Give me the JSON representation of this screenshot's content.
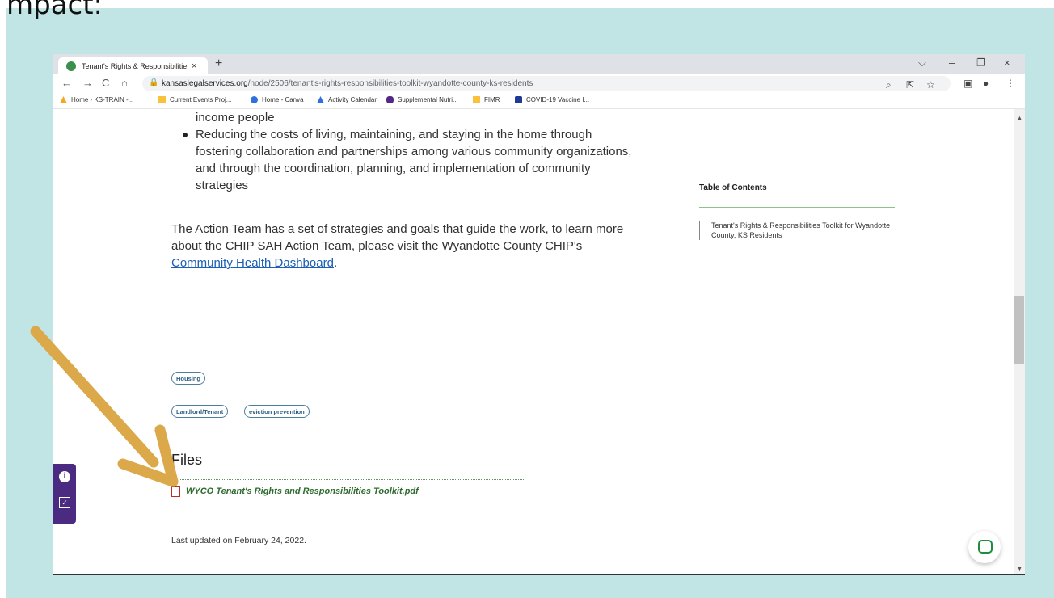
{
  "caption_partial": "mpact:",
  "browser": {
    "tab_title": "Tenant's Rights & Responsibilitie",
    "tab_close": "×",
    "new_tab": "+",
    "url_host": "kansaslegalservices.org",
    "url_path": "/node/2506/tenant's-rights-responsibilities-toolkit-wyandotte-county-ks-residents",
    "window_controls": {
      "dropdown": "⌵",
      "minimize": "–",
      "restore": "❐",
      "close": "×"
    },
    "nav": {
      "back": "←",
      "forward": "→",
      "reload": "C",
      "home": "⌂"
    },
    "bookmarks": [
      {
        "label": "Home - KS-TRAIN -...",
        "color": "#f5a623"
      },
      {
        "label": "Current Events Proj...",
        "color": "#f9c23c"
      },
      {
        "label": "Home - Canva",
        "color": "#2f6fde"
      },
      {
        "label": "Activity Calendar",
        "color": "#2f6fde"
      },
      {
        "label": "Supplemental Nutri...",
        "color": "#512888"
      },
      {
        "label": "FIMR",
        "color": "#f9c23c"
      },
      {
        "label": "COVID-19 Vaccine I...",
        "color": "#1f3a93"
      }
    ]
  },
  "content": {
    "bullet1_tail": "income people",
    "bullet2_lines": [
      "Reducing the costs of living, maintaining, and staying in the home through",
      "fostering collaboration and partnerships among various community organizations,",
      "and through the coordination, planning, and implementation of community",
      "strategies"
    ],
    "para_line1": "The Action Team has a set of strategies and goals that guide the work, to learn more",
    "para_line2": "about the CHIP SAH Action Team, please visit the Wyandotte County CHIP's",
    "para_link": "Community Health Dashboard",
    "para_end": ".",
    "toc_title": "Table of Contents",
    "toc_item": "Tenant's Rights & Responsibilities Toolkit for Wyandotte County, KS Residents",
    "tags": [
      "Housing",
      "Landlord/Tenant",
      "eviction prevention"
    ],
    "files_heading": "Files",
    "file_link": "WYCO Tenant's Rights and Responsibilities Toolkit.pdf",
    "last_updated": "Last updated on February 24, 2022."
  },
  "colors": {
    "background": "#c1e4e4",
    "arrow": "#dba84a",
    "widget": "#4b2a82",
    "chat": "#1e8e3e"
  }
}
